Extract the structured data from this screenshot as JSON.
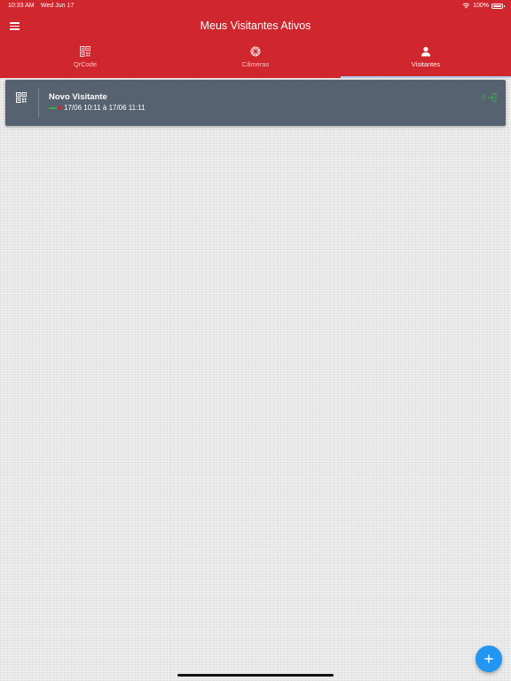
{
  "status_bar": {
    "time": "10:33 AM",
    "date": "Wed Jun 17",
    "battery": "100%"
  },
  "header": {
    "title": "Meus Visitantes Ativos",
    "menu_icon": "hamburger-menu-icon"
  },
  "tabs": [
    {
      "label": "QrCode",
      "icon": "qrcode-icon",
      "active": false
    },
    {
      "label": "Câmeras",
      "icon": "camera-shutter-icon",
      "active": false
    },
    {
      "label": "Visitantes",
      "icon": "person-icon",
      "active": true
    }
  ],
  "visitors": [
    {
      "name": "Novo Visitante",
      "period": "17/06 10:11 à 17/06 11:11",
      "count": "0",
      "icon": "qrcode-icon"
    }
  ],
  "fab": {
    "icon": "plus-icon"
  },
  "colors": {
    "header": "#d0262d",
    "card": "#576270",
    "accent_green": "#3fae49",
    "fab": "#2196f3",
    "tab_indicator": "#b5cbe9"
  }
}
